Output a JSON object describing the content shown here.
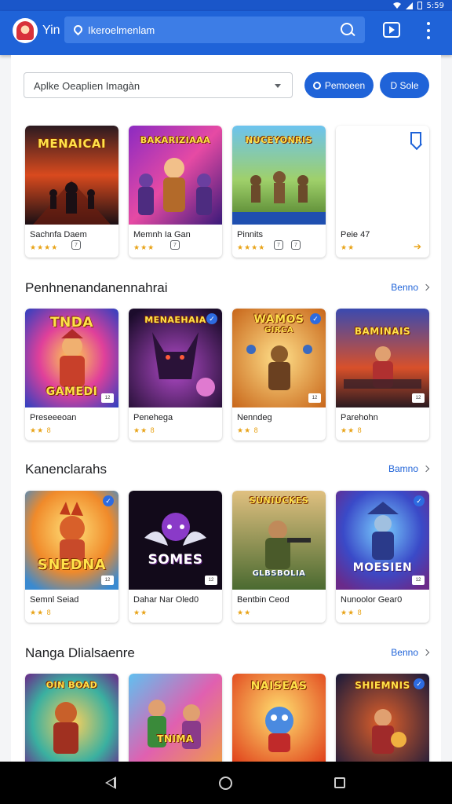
{
  "status": {
    "time": "5:59"
  },
  "appbar": {
    "title": "Yin",
    "search_text": "Ikeroelmenlam"
  },
  "filters": {
    "select_value": "Aplke Oeaplien Imagàn",
    "pill_1": "Pemoeen",
    "pill_2": "D Sole"
  },
  "featured": [
    {
      "title": "Sachnfa Daem",
      "rating": "★★★★",
      "art_text": "MENAICAI"
    },
    {
      "title": "Memnh Ia Gan",
      "rating": "★★★",
      "art_text": "BAKARIZIAAA"
    },
    {
      "title": "Pinnits",
      "rating": "★★★★",
      "art_text": "NUCEYONRIS"
    },
    {
      "title": "Peie 47",
      "rating": "★★",
      "art_text": ""
    }
  ],
  "sections": [
    {
      "title": "Penhnenandanennahrai",
      "more": "Benno",
      "cards": [
        {
          "title": "Preseeeoan",
          "rating": "★★ 8",
          "art_text": "TNDA",
          "sub": "GAMEDI"
        },
        {
          "title": "Penehega",
          "rating": "★★ 8",
          "art_text": "MENAEHAIA",
          "sub": ""
        },
        {
          "title": "Nenndeg",
          "rating": "★★ 8",
          "art_text": "WAMOS",
          "sub": "GIRCA"
        },
        {
          "title": "Parehohn",
          "rating": "★★ 8",
          "art_text": "BAMINAIS",
          "sub": ""
        }
      ]
    },
    {
      "title": "Kanenclarahs",
      "more": "Bamno",
      "cards": [
        {
          "title": "Semnl Seiad",
          "rating": "★★ 8",
          "art_text": "SNEDNA",
          "sub": ""
        },
        {
          "title": "Dahar Nar Oled0",
          "rating": "★★",
          "art_text": "SOMES",
          "sub": ""
        },
        {
          "title": "Bentbin Ceod",
          "rating": "★★",
          "art_text": "SUNIUCKES",
          "sub": "GLBSBOLIA"
        },
        {
          "title": "Nunoolor Gear0",
          "rating": "★★ 8",
          "art_text": "MOESIEN",
          "sub": ""
        }
      ]
    },
    {
      "title": "Nanga Dlialsaenre",
      "more": "Benno",
      "cards": [
        {
          "title": "",
          "rating": "",
          "art_text": "OIN BOAD",
          "sub": ""
        },
        {
          "title": "",
          "rating": "",
          "art_text": "TNIMA",
          "sub": ""
        },
        {
          "title": "",
          "rating": "",
          "art_text": "NAISEAS",
          "sub": ""
        },
        {
          "title": "",
          "rating": "",
          "art_text": "SHIEMNIS",
          "sub": ""
        }
      ]
    }
  ],
  "colors": {
    "primary": "#1f63d8",
    "appbar": "#1f63d8",
    "star": "#e8a317"
  }
}
